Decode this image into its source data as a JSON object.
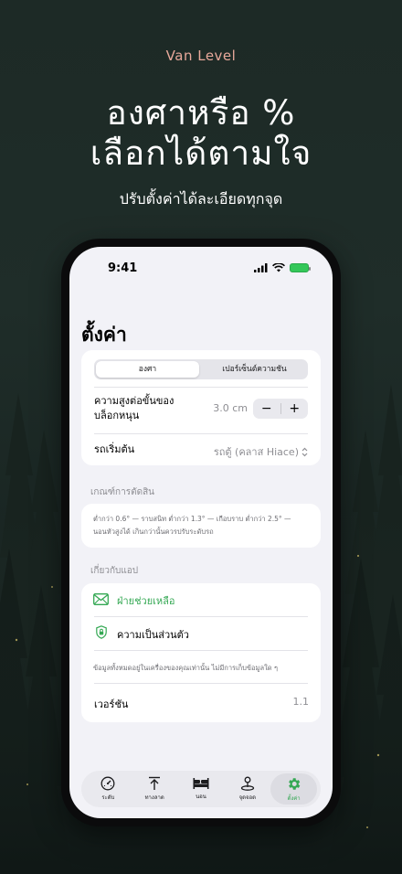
{
  "promo": {
    "brand": "Van Level",
    "headline_line1": "องศาหรือ %",
    "headline_line2": "เลือกได้ตามใจ",
    "subhead": "ปรับตั้งค่าได้ละเอียดทุกจุด"
  },
  "status_bar": {
    "time": "9:41"
  },
  "settings": {
    "title": "ตั้งค่า",
    "units_segment": {
      "options": [
        "องศา",
        "เปอร์เซ็นต์ความชัน"
      ],
      "selected": "องศา"
    },
    "block_height": {
      "label_line1": "ความสูงต่อขั้นของ",
      "label_line2": "บล็อกหนุน",
      "value": "3.0 cm",
      "minus": "−",
      "plus": "+"
    },
    "vehicle": {
      "label": "รถเริ่มต้น",
      "value": "รถตู้ (คลาส Hiace)",
      "chevron": "⌃⌄"
    },
    "criteria": {
      "header": "เกณฑ์การตัดสิน",
      "line1": "ต่ำกว่า 0.6° — ราบสนิท ต่ำกว่า 1.3° — เกือบราบ ต่ำกว่า 2.5° —",
      "line2": "นอนหัวสูงได้ เกินกว่านั้นควรปรับระดับรถ"
    },
    "about": {
      "header": "เกี่ยวกับแอป",
      "support": "ฝ่ายช่วยเหลือ",
      "privacy": "ความเป็นส่วนตัว",
      "note": "ข้อมูลทั้งหมดอยู่ในเครื่องของคุณเท่านั้น ไม่มีการเก็บข้อมูลใด ๆ",
      "version_label": "เวอร์ชัน",
      "version_value": "1.1"
    }
  },
  "tabbar": {
    "tabs": [
      {
        "label": "ระดับ",
        "icon": "gauge-icon"
      },
      {
        "label": "ทางลาด",
        "icon": "ramp-arrow-icon"
      },
      {
        "label": "นอน",
        "icon": "bed-icon"
      },
      {
        "label": "จุดจอด",
        "icon": "map-pin-icon"
      },
      {
        "label": "ตั้งค่า",
        "icon": "gear-icon",
        "active": true
      }
    ]
  },
  "colors": {
    "accent": "#34a853",
    "brand": "#e8a89a",
    "background": "#1d2a26"
  }
}
